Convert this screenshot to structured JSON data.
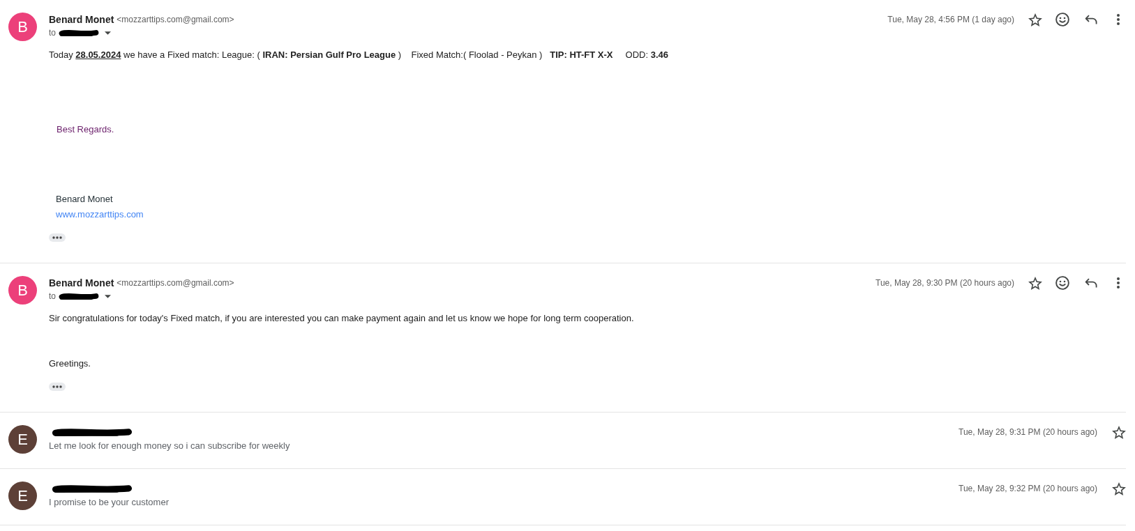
{
  "messages": [
    {
      "expanded": true,
      "avatar": {
        "letter": "B",
        "color": "#ec407a"
      },
      "sender": "Benard Monet",
      "email": "<mozzarttips.com@gmail.com>",
      "recipient_prefix": "to",
      "date": "Tue, May 28, 4:56 PM (1 day ago)",
      "starred": false,
      "body": [
        {
          "kind": "text",
          "runs": [
            {
              "text": "Today "
            },
            {
              "kind": "date_link",
              "text": "28.05.2024"
            },
            {
              "text": " we have a Fixed match: League: ( **IRAN: Persian Gulf Pro League** )    Fixed Match:( Floolad - Peykan )   **TIP: HT-FT X-X**     ODD: **3.46**"
            }
          ]
        },
        {
          "kind": "closing",
          "text": "Best Regards."
        },
        {
          "kind": "signature",
          "text": "Benard Monet"
        },
        {
          "kind": "link",
          "text": "www.mozzarttips.com"
        }
      ]
    },
    {
      "expanded": true,
      "avatar": {
        "letter": "B",
        "color": "#ec407a"
      },
      "sender": "Benard Monet",
      "email": "<mozzarttips.com@gmail.com>",
      "recipient_prefix": "to",
      "date": "Tue, May 28, 9:30 PM (20 hours ago)",
      "starred": false,
      "body": [
        {
          "kind": "text",
          "runs": [
            {
              "text": "Sir congratulations for today's Fixed match, if you are interested you can make payment again and let us know we hope for long term cooperation."
            }
          ]
        },
        {
          "kind": "greeting",
          "text": "Greetings."
        }
      ]
    },
    {
      "expanded": false,
      "avatar": {
        "letter": "E",
        "color": "#5d4037"
      },
      "snippet": "Let me look for enough money so i can subscribe for weekly",
      "date": "Tue, May 28, 9:31 PM (20 hours ago)",
      "starred": false
    },
    {
      "expanded": false,
      "avatar": {
        "letter": "E",
        "color": "#5d4037"
      },
      "snippet": "I promise to be your customer",
      "date": "Tue, May 28, 9:32 PM (20 hours ago)",
      "starred": false
    }
  ]
}
